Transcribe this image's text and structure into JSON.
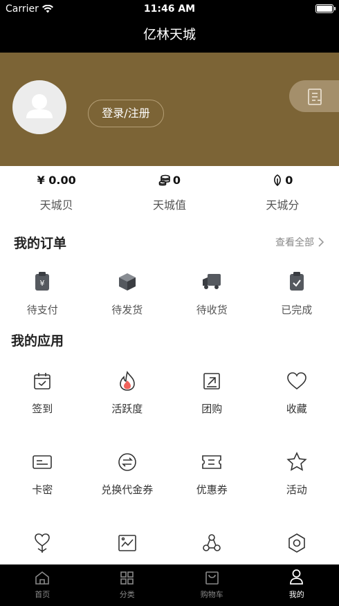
{
  "status_bar": {
    "carrier": "Carrier",
    "time": "11:46 AM"
  },
  "nav": {
    "title": "亿林天城"
  },
  "profile": {
    "login_label": "登录/注册",
    "avatar_icon": "user-placeholder-icon",
    "message_icon": "document-icon"
  },
  "stats": [
    {
      "value": "¥ 0.00",
      "label": "天城贝",
      "icon": ""
    },
    {
      "value": "0",
      "label": "天城值",
      "icon": "coins-stack-icon"
    },
    {
      "value": "0",
      "label": "天城分",
      "icon": "leaf-icon"
    }
  ],
  "orders": {
    "title": "我的订单",
    "view_all": "查看全部",
    "items": [
      {
        "label": "待支付",
        "icon": "wallet-yen-icon"
      },
      {
        "label": "待发货",
        "icon": "package-box-icon"
      },
      {
        "label": "待收货",
        "icon": "delivery-truck-icon"
      },
      {
        "label": "已完成",
        "icon": "clipboard-check-icon"
      }
    ]
  },
  "apps": {
    "title": "我的应用",
    "rows": [
      [
        {
          "label": "签到",
          "icon": "calendar-check-icon"
        },
        {
          "label": "活跃度",
          "icon": "flame-icon"
        },
        {
          "label": "团购",
          "icon": "square-arrow-icon"
        },
        {
          "label": "收藏",
          "icon": "heart-icon"
        }
      ],
      [
        {
          "label": "卡密",
          "icon": "card-icon"
        },
        {
          "label": "兑换代金券",
          "icon": "exchange-icon"
        },
        {
          "label": "优惠券",
          "icon": "ticket-icon"
        },
        {
          "label": "活动",
          "icon": "star-icon"
        }
      ],
      [
        {
          "label": "",
          "icon": "heart-hand-icon"
        },
        {
          "label": "",
          "icon": "image-chart-icon"
        },
        {
          "label": "",
          "icon": "share-network-icon"
        },
        {
          "label": "",
          "icon": "settings-hexagon-icon"
        }
      ]
    ]
  },
  "tabbar": [
    {
      "label": "首页",
      "icon": "home-icon"
    },
    {
      "label": "分类",
      "icon": "grid-icon"
    },
    {
      "label": "购物车",
      "icon": "cart-icon"
    },
    {
      "label": "我的",
      "icon": "person-icon",
      "active": true
    }
  ],
  "colors": {
    "banner": "#7c6436",
    "bar": "#000000",
    "accent_flame": "#f0625b"
  }
}
